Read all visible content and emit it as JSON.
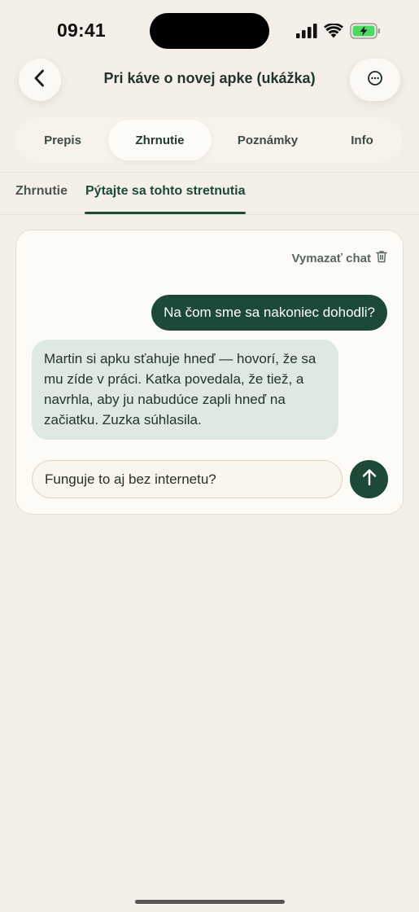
{
  "status_bar": {
    "time": "09:41",
    "icons": [
      "cellular-signal-icon",
      "wifi-icon",
      "battery-charging-icon"
    ]
  },
  "header": {
    "title": "Pri káve o novej apke (ukážka)",
    "back_icon": "chevron-left-icon",
    "more_icon": "ellipsis-circle-icon"
  },
  "tabs": [
    {
      "label": "Prepis",
      "active": false
    },
    {
      "label": "Zhrnutie",
      "active": true
    },
    {
      "label": "Poznámky",
      "active": false
    },
    {
      "label": "Info",
      "active": false
    }
  ],
  "subtabs": [
    {
      "label": "Zhrnutie",
      "active": false
    },
    {
      "label": "Pýtajte sa tohto stretnutia",
      "active": true
    }
  ],
  "chat": {
    "clear_label": "Vymazať chat",
    "clear_icon": "trash-icon",
    "messages": [
      {
        "role": "user",
        "text": "Na čom sme sa nakoniec dohodli?"
      },
      {
        "role": "assistant",
        "text": "Martin si apku sťahuje hneď — hovorí, že sa mu zíde v práci. Katka povedala, že tiež, a navrhla, aby ju nabudúce zapli hneď na začiatku. Zuzka súhlasila."
      }
    ],
    "input_value": "Funguje to aj bez internetu?",
    "send_icon": "arrow-up-icon"
  },
  "colors": {
    "accent": "#1d4a38",
    "background": "#f4f0e9",
    "assistant_bubble": "#dde9e1",
    "battery": "#4cd964"
  }
}
